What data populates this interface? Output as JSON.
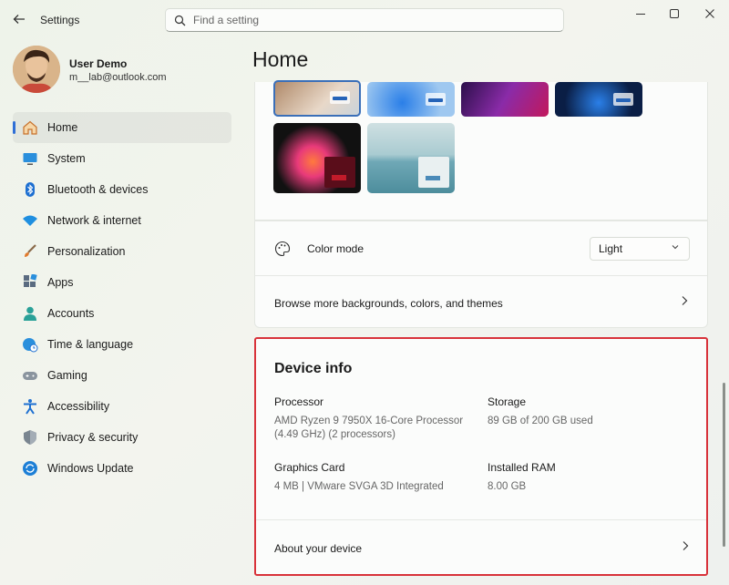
{
  "window": {
    "title": "Settings",
    "controls": [
      "minimize",
      "maximize",
      "close"
    ]
  },
  "search": {
    "placeholder": "Find a setting",
    "value": ""
  },
  "user": {
    "name": "User Demo",
    "email": "m__lab@outlook.com"
  },
  "sidebar": {
    "items": [
      {
        "label": "Home",
        "icon": "home-icon",
        "active": true
      },
      {
        "label": "System",
        "icon": "monitor-icon"
      },
      {
        "label": "Bluetooth & devices",
        "icon": "bluetooth-icon"
      },
      {
        "label": "Network & internet",
        "icon": "wifi-icon"
      },
      {
        "label": "Personalization",
        "icon": "brush-icon"
      },
      {
        "label": "Apps",
        "icon": "apps-icon"
      },
      {
        "label": "Accounts",
        "icon": "person-icon"
      },
      {
        "label": "Time & language",
        "icon": "globe-clock-icon"
      },
      {
        "label": "Gaming",
        "icon": "gamepad-icon"
      },
      {
        "label": "Accessibility",
        "icon": "accessibility-icon"
      },
      {
        "label": "Privacy & security",
        "icon": "shield-icon"
      },
      {
        "label": "Windows Update",
        "icon": "update-icon"
      }
    ]
  },
  "main": {
    "title": "Home",
    "color_mode": {
      "label": "Color mode",
      "value": "Light"
    },
    "browse_link": "Browse more backgrounds, colors, and themes",
    "device_info": {
      "title": "Device info",
      "processor_label": "Processor",
      "processor_value": "AMD Ryzen 9 7950X 16-Core Processor (4.49 GHz) (2 processors)",
      "storage_label": "Storage",
      "storage_value": "89 GB of 200 GB used",
      "graphics_label": "Graphics Card",
      "graphics_value": "4 MB | VMware SVGA 3D Integrated",
      "ram_label": "Installed RAM",
      "ram_value": "8.00 GB",
      "about_link": "About your device"
    }
  },
  "colors": {
    "accent": "#2f6fd6",
    "highlight_border": "#d8323a"
  }
}
